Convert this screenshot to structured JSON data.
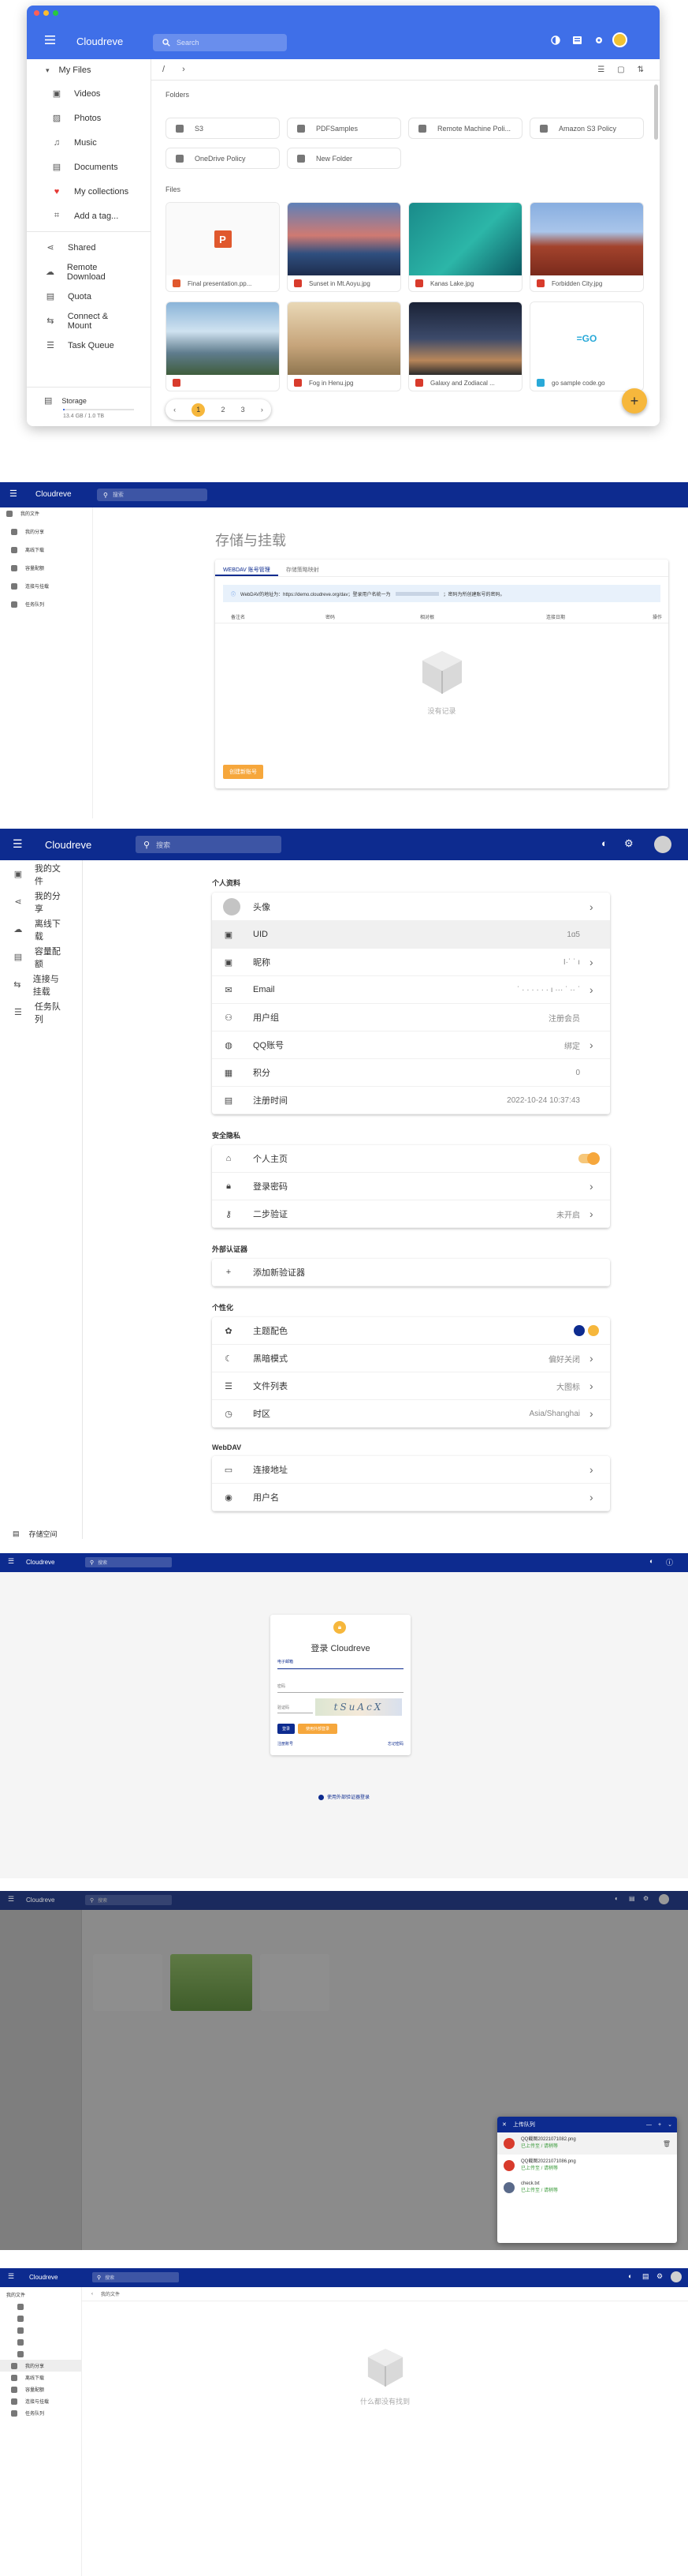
{
  "colors": {
    "brand": "#3f6fe8",
    "nav": "#0d2b8f",
    "accent": "#f6b73c",
    "red": "#d83b2c"
  },
  "s1": {
    "app_title": "Cloudreve",
    "search_placeholder": "Search",
    "my_files": "My Files",
    "nav": [
      "Videos",
      "Photos",
      "Music",
      "Documents",
      "My collections",
      "Add a tag..."
    ],
    "nav2": [
      "Shared",
      "Remote Download",
      "Quota",
      "Connect & Mount",
      "Task Queue"
    ],
    "storage_label": "Storage",
    "storage_value": "13.4 GB / 1.0 TB",
    "breadcrumb_sep": "/",
    "folders_title": "Folders",
    "folders": [
      "S3",
      "PDFSamples",
      "Remote Machine Poli...",
      "Amazon S3 Policy",
      "OneDrive Policy",
      "New Folder"
    ],
    "files_title": "Files",
    "files": [
      "Final presentation.pp...",
      "Sunset in Mt.Aoyu.jpg",
      "Kanas Lake.jpg",
      "Forbidden City.jpg",
      "",
      "Fog in Henu.jpg",
      "Galaxy and Zodiacal ...",
      "go sample code.go"
    ],
    "pages": [
      "1",
      "2",
      "3"
    ],
    "fab": "+"
  },
  "s2": {
    "app_title": "Cloudreve",
    "search_placeholder": "搜索",
    "nav": [
      "我的文件",
      "我的分享",
      "离线下载",
      "容量配额",
      "连接与挂载",
      "任务队列"
    ],
    "page_title": "存储与挂载",
    "tabs": [
      "WEBDAV 账号管理",
      "存储策略映射"
    ],
    "notice": "WebDAV的地址为：https://demo.cloudreve.org/dav；登录用户名统一为",
    "notice2": "；密码为所创建账号的密码。",
    "cols": [
      "备注名",
      "密码",
      "相对根",
      "连接日期",
      "操作"
    ],
    "empty": "没有记录",
    "create_btn": "创建新账号"
  },
  "s3": {
    "app_title": "Cloudreve",
    "search_placeholder": "搜索",
    "nav": [
      "我的文件",
      "我的分享",
      "离线下载",
      "容量配额",
      "连接与挂载",
      "任务队列"
    ],
    "bottom_nav": "存储空间",
    "sec_profile": "个人资料",
    "avatar": "头像",
    "profile": [
      {
        "label": "UID",
        "value": "1ɑ5",
        "chev": ""
      },
      {
        "label": "昵称",
        "value": "I·ˈ ˈ ı",
        "chev": "›"
      },
      {
        "label": "Email",
        "value": "ˈ · · · · · · ı ··· ˈ ·· ˈ",
        "chev": "›"
      },
      {
        "label": "用户组",
        "value": "注册会员",
        "chev": ""
      },
      {
        "label": "QQ账号",
        "value": "绑定",
        "chev": "›"
      },
      {
        "label": "积分",
        "value": "0",
        "chev": ""
      },
      {
        "label": "注册时间",
        "value": "2022-10-24 10:37:43",
        "chev": ""
      }
    ],
    "sec_security": "安全隐私",
    "security": [
      {
        "label": "个人主页",
        "value": "",
        "chev": ""
      },
      {
        "label": "登录密码",
        "value": "",
        "chev": "›"
      },
      {
        "label": "二步验证",
        "value": "未开启",
        "chev": "›"
      }
    ],
    "sec_auth": "外部认证器",
    "auth": "添加新验证器",
    "sec_personal": "个性化",
    "personal": [
      {
        "label": "主题配色",
        "value": "",
        "chev": ""
      },
      {
        "label": "黑暗模式",
        "value": "偏好关闭",
        "chev": "›"
      },
      {
        "label": "文件列表",
        "value": "大图标",
        "chev": "›"
      },
      {
        "label": "时区",
        "value": "Asia/Shanghai",
        "chev": "›"
      }
    ],
    "sec_webdav": "WebDAV",
    "webdav": [
      {
        "label": "连接地址",
        "value": "",
        "chev": "›"
      },
      {
        "label": "用户名",
        "value": "",
        "chev": "›"
      }
    ]
  },
  "s4": {
    "app_title": "Cloudreve",
    "search_placeholder": "搜索",
    "title": "登录 Cloudreve",
    "email_label": "电子邮箱",
    "password_label": "密码",
    "captcha_label": "验证码",
    "captcha_text": "tSuAcX",
    "login_btn": "登录",
    "external_btn": "使用外部登录",
    "register": "注册账号",
    "forgot": "忘记密码",
    "passkey": "使用外部验证器登录"
  },
  "s5": {
    "app_title": "Cloudreve",
    "search_placeholder": "搜索",
    "queue_title": "上传队列",
    "queue": [
      {
        "name": "QQ截图20221071082.png",
        "meta": "已上传至 / 请稍等"
      },
      {
        "name": "QQ截图20221071086.png",
        "meta": "已上传至 / 请稍等"
      },
      {
        "name": "check.txt",
        "meta": "已上传至 / 请稍等"
      }
    ]
  },
  "s6": {
    "app_title": "Cloudreve",
    "search_placeholder": "搜索",
    "empty": "什么都没有找到",
    "breadcrumb": "我的文件"
  }
}
